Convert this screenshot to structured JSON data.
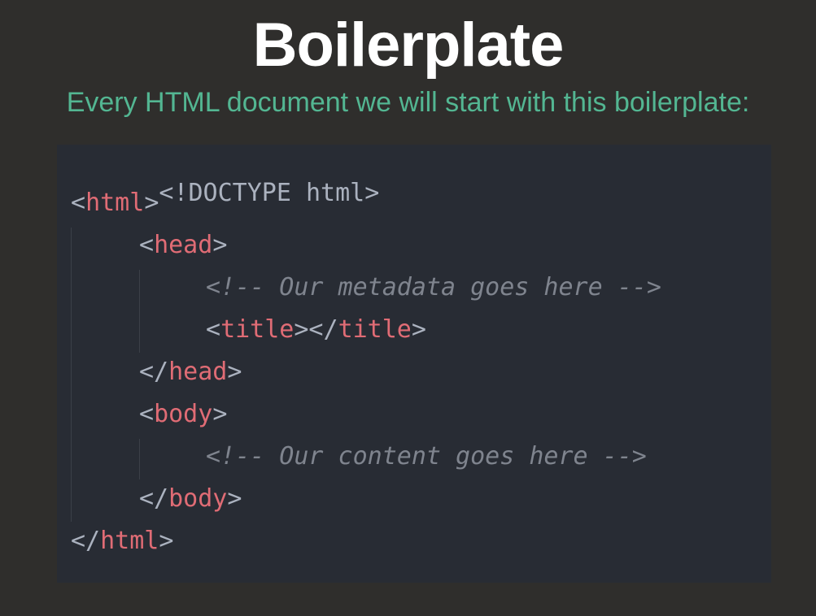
{
  "slide": {
    "title": "Boilerplate",
    "subtitle": "Every HTML document we will start with this boilerplate:"
  },
  "code": {
    "doctype": "<!DOCTYPE html>",
    "html_tag": "html",
    "head_tag": "head",
    "metadata_comment": "<!-- Our metadata goes here -->",
    "title_tag": "title",
    "body_tag": "body",
    "content_comment": "<!-- Our content goes here -->"
  },
  "colors": {
    "background": "#2f2e2c",
    "title": "#ffffff",
    "subtitle": "#53b692",
    "code_background": "#282c34",
    "code_tag": "#e06c75",
    "code_punctuation": "#abb2bf",
    "code_comment": "#7f848e"
  }
}
